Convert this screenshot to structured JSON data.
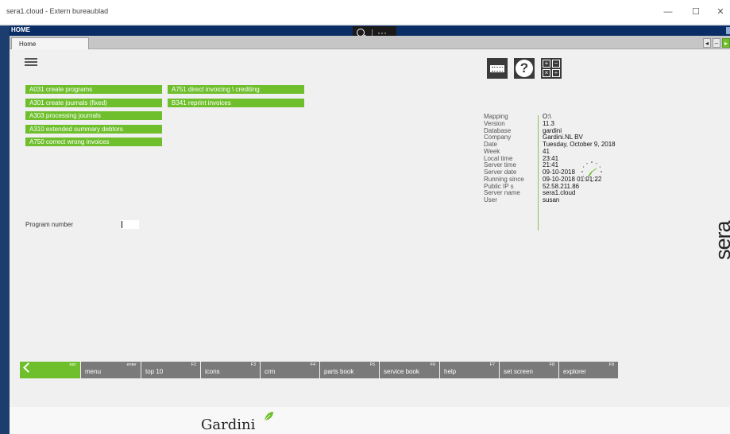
{
  "window": {
    "title": "sera1.cloud - Extern bureaublad",
    "minimize": "—",
    "maximize": "☐",
    "close": "✕"
  },
  "homebar": {
    "label": "HOME"
  },
  "zoom": {
    "separator": "|",
    "more": "···"
  },
  "tabs": [
    {
      "label": "Home"
    }
  ],
  "tab_nav": {
    "left": "◂",
    "minus": "–",
    "right": "▸"
  },
  "menu_buttons_left": [
    "A031 create programs",
    "A301 create journals (fixed)",
    "A303 processing journals",
    "A310 extended summary debtors",
    "A750 correct wrong invoices"
  ],
  "menu_buttons_right": [
    "A751 direct invoicing \\ crediting",
    "B341 reprint invoices"
  ],
  "top_icons": {
    "help": "?",
    "calc_symbols": [
      "+",
      "−",
      "×",
      "÷"
    ]
  },
  "info": [
    {
      "label": "Mapping",
      "value": "O:\\"
    },
    {
      "label": "Version",
      "value": "11.3"
    },
    {
      "label": "Database",
      "value": "gardini"
    },
    {
      "label": "Company",
      "value": "Gardini.NL BV"
    },
    {
      "label": "Date",
      "value": "Tuesday, October 9, 2018"
    },
    {
      "label": "Week",
      "value": "41"
    },
    {
      "label": "Local time",
      "value": "23:41"
    },
    {
      "label": "Server time",
      "value": "21:41"
    },
    {
      "label": "Server date",
      "value": "09-10-2018"
    },
    {
      "label": "Running since",
      "value": "09-10-2018 01:01:22"
    },
    {
      "label": "Public IP s",
      "value": "52.58.211.86"
    },
    {
      "label": "Server name",
      "value": "sera1.cloud"
    },
    {
      "label": "User",
      "value": "susan"
    }
  ],
  "program": {
    "label": "Program number",
    "value": ""
  },
  "brand": {
    "sera": "sera",
    "gardini": "Gardini",
    "accent": "#6fbf2d"
  },
  "function_keys": [
    {
      "label": "menu",
      "key": "esc"
    },
    {
      "label": "top 10",
      "key": "enter"
    },
    {
      "label": "icons",
      "key": "F2"
    },
    {
      "label": "crm",
      "key": "F3"
    },
    {
      "label": "parts book",
      "key": "F4"
    },
    {
      "label": "service book",
      "key": "F5"
    },
    {
      "label": "help",
      "key": "F6"
    },
    {
      "label": "set screen",
      "key": "F7"
    },
    {
      "label": "explorer",
      "key": "F8"
    },
    {
      "label": "",
      "key": "F9"
    }
  ]
}
